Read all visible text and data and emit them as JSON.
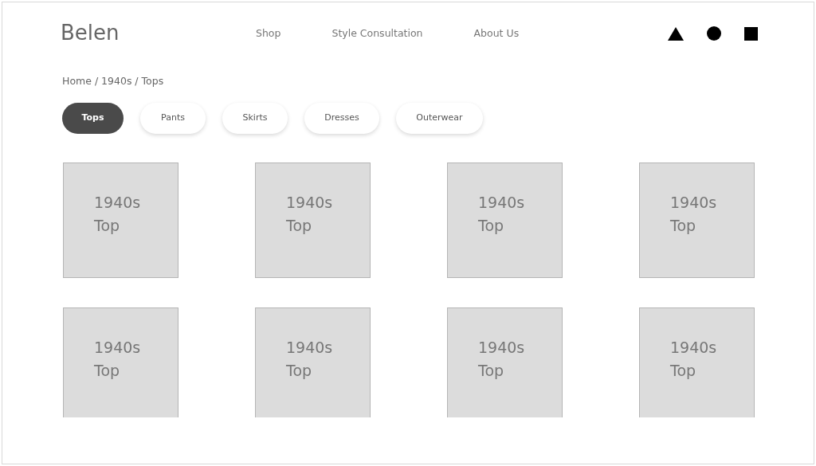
{
  "brand": "Belen",
  "nav": [
    "Shop",
    "Style Consultation",
    "About Us"
  ],
  "breadcrumb": "Home / 1940s / Tops",
  "categories": [
    {
      "label": "Tops",
      "selected": true
    },
    {
      "label": "Pants",
      "selected": false
    },
    {
      "label": "Skirts",
      "selected": false
    },
    {
      "label": "Dresses",
      "selected": false
    },
    {
      "label": "Outerwear",
      "selected": false
    }
  ],
  "products": [
    {
      "label": "1940s Top"
    },
    {
      "label": "1940s Top"
    },
    {
      "label": "1940s Top"
    },
    {
      "label": "1940s Top"
    },
    {
      "label": "1940s Top"
    },
    {
      "label": "1940s Top"
    },
    {
      "label": "1940s Top"
    },
    {
      "label": "1940s Top"
    }
  ]
}
